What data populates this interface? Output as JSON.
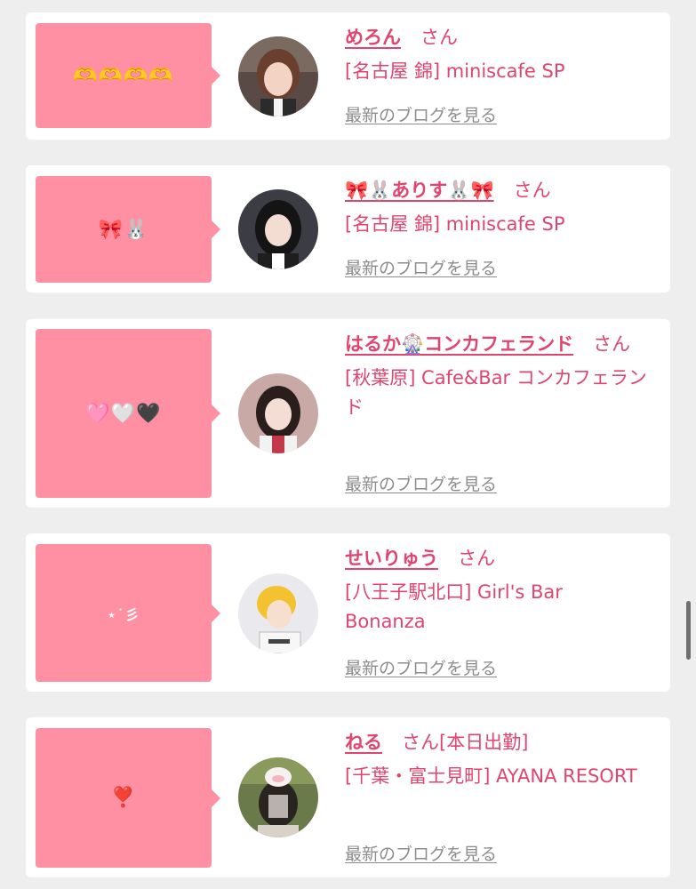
{
  "entries": [
    {
      "bubble": "🫶🫶🫶🫶",
      "name": "めろん",
      "honorific": "さん",
      "shop": "[名古屋 錦] miniscafe SP",
      "blog_link": "最新のブログを見る"
    },
    {
      "bubble": "🎀🐰",
      "name": "🎀🐰ありす🐰🎀",
      "honorific": "さん",
      "shop": "[名古屋 錦] miniscafe SP",
      "blog_link": "最新のブログを見る"
    },
    {
      "bubble": "🩷🤍🖤",
      "name": "はるか🎡コンカフェランド",
      "honorific": "さん",
      "shop": "[秋葉原] Cafe&Bar コンカフェランド",
      "blog_link": "最新のブログを見る"
    },
    {
      "bubble": "⋆˙彡",
      "name": "せいりゅう",
      "honorific": "さん",
      "shop": "[八王子駅北口] Girl's Bar Bonanza",
      "blog_link": "最新のブログを見る"
    },
    {
      "bubble": "❣️",
      "name": "ねる",
      "honorific": "さん[本日出勤]",
      "shop": "[千葉・富士見町] AYANA RESORT",
      "blog_link": "最新のブログを見る"
    }
  ],
  "colors": {
    "bubble": "#ff8fa2",
    "accent": "#e0446f",
    "link_gray": "#8c8c8c",
    "background": "#eeeeee"
  }
}
